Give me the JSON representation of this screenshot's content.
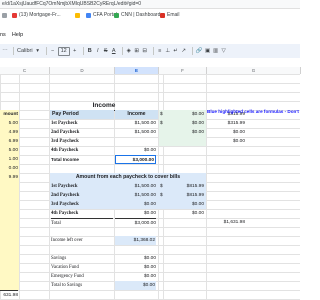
{
  "browser": {
    "url": "e/d/1aXsjUaudfFCq7OmNmjbXMIqUBSB2CyRErqL/edit#gid=0",
    "bookmarks": [
      {
        "label": "",
        "color": "#9aa0a6"
      },
      {
        "label": "(13) Mortgage-Fr...",
        "color": "#e53935"
      },
      {
        "label": "",
        "color": "#fbbc04"
      },
      {
        "label": "CFA Portal",
        "color": "#4285f4"
      },
      {
        "label": "CNN | Dashboard",
        "color": "#34a853"
      },
      {
        "label": "Email",
        "color": "#d93025"
      }
    ]
  },
  "menu": [
    "ns",
    "Help"
  ],
  "toolbar": {
    "font": "Calibri",
    "font_size": "12",
    "minus": "−",
    "plus": "+",
    "bold": "B",
    "italic": "I",
    "strike": "S",
    "text_color": "A"
  },
  "columns": [
    {
      "label": "C",
      "sel": false
    },
    {
      "label": "D",
      "sel": false
    },
    {
      "label": "E",
      "sel": true
    },
    {
      "label": "F",
      "sel": false
    },
    {
      "label": "G",
      "sel": false
    }
  ],
  "left_col": {
    "header": "mount",
    "values": [
      "5.00",
      "4.99",
      "6.99",
      "5.00",
      "1.00",
      "0.00",
      "9.99"
    ],
    "total": "631.98"
  },
  "income": {
    "title": "Income",
    "col_period": "Pay Period",
    "col_income": "Income",
    "rows": [
      {
        "label": "1st Paycheck",
        "value": "$1,500.00"
      },
      {
        "label": "2nd Paycheck",
        "value": "$1,500.00"
      },
      {
        "label": "3rd Paycheck",
        "value": ""
      },
      {
        "label": "4th Paycheck",
        "value": "$0.00"
      }
    ],
    "total_label": "Total Income",
    "total_value": "$3,000.00"
  },
  "note": "Blue highlighted cells are formulas - Don't t",
  "right_col": {
    "rows": [
      {
        "sym": "$",
        "value": "$0.00",
        "extra": "$315.99"
      },
      {
        "sym": "$",
        "value": "$0.00",
        "extra": "$315.99"
      },
      {
        "sym": "",
        "value": "$0.00",
        "extra": "$0.00"
      },
      {
        "sym": "",
        "value": "",
        "extra": "$0.00"
      }
    ]
  },
  "bills": {
    "title": "Amount from each paycheck to cover bills",
    "rows": [
      {
        "label": "1st Paycheck",
        "value": "$1,500.00",
        "sym": "$",
        "extra": "$815.99"
      },
      {
        "label": "2nd Paycheck",
        "value": "$1,500.00",
        "sym": "$",
        "extra": "$815.99"
      },
      {
        "label": "3rd Paycheck",
        "value": "$0.00",
        "sym": "",
        "extra": "$0.00"
      },
      {
        "label": "4th Paycheck",
        "value": "$0.00",
        "sym": "",
        "extra": "$0.00"
      }
    ],
    "total_label": "Total",
    "total_value": "$3,000.00",
    "total_extra": "$1,631.98"
  },
  "leftover": {
    "label": "Income left over",
    "value": "$1,368.02"
  },
  "savings": {
    "rows": [
      {
        "label": "Savings",
        "value": "$0.00"
      },
      {
        "label": "Vacation Fund",
        "value": "$0.00"
      },
      {
        "label": "Emergency Fund",
        "value": "$0.00"
      }
    ],
    "total_label": "Total to Savings",
    "total_value": "$0.00"
  }
}
